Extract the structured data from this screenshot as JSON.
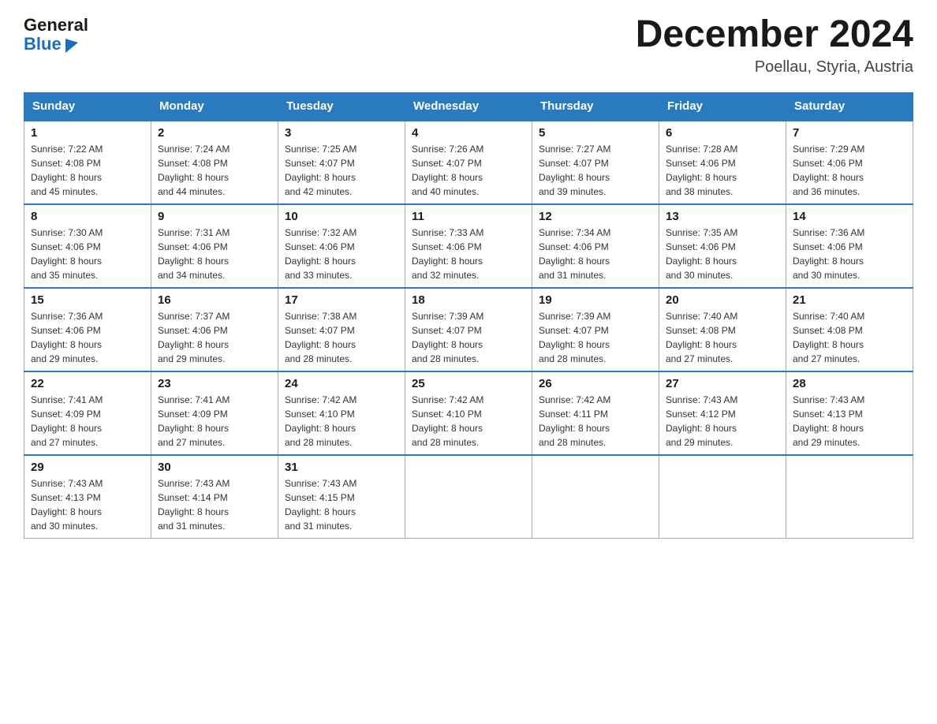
{
  "header": {
    "logo_general": "General",
    "logo_blue": "Blue",
    "month_title": "December 2024",
    "location": "Poellau, Styria, Austria"
  },
  "days_of_week": [
    "Sunday",
    "Monday",
    "Tuesday",
    "Wednesday",
    "Thursday",
    "Friday",
    "Saturday"
  ],
  "weeks": [
    [
      {
        "day": "1",
        "sunrise": "7:22 AM",
        "sunset": "4:08 PM",
        "daylight": "8 hours and 45 minutes."
      },
      {
        "day": "2",
        "sunrise": "7:24 AM",
        "sunset": "4:08 PM",
        "daylight": "8 hours and 44 minutes."
      },
      {
        "day": "3",
        "sunrise": "7:25 AM",
        "sunset": "4:07 PM",
        "daylight": "8 hours and 42 minutes."
      },
      {
        "day": "4",
        "sunrise": "7:26 AM",
        "sunset": "4:07 PM",
        "daylight": "8 hours and 40 minutes."
      },
      {
        "day": "5",
        "sunrise": "7:27 AM",
        "sunset": "4:07 PM",
        "daylight": "8 hours and 39 minutes."
      },
      {
        "day": "6",
        "sunrise": "7:28 AM",
        "sunset": "4:06 PM",
        "daylight": "8 hours and 38 minutes."
      },
      {
        "day": "7",
        "sunrise": "7:29 AM",
        "sunset": "4:06 PM",
        "daylight": "8 hours and 36 minutes."
      }
    ],
    [
      {
        "day": "8",
        "sunrise": "7:30 AM",
        "sunset": "4:06 PM",
        "daylight": "8 hours and 35 minutes."
      },
      {
        "day": "9",
        "sunrise": "7:31 AM",
        "sunset": "4:06 PM",
        "daylight": "8 hours and 34 minutes."
      },
      {
        "day": "10",
        "sunrise": "7:32 AM",
        "sunset": "4:06 PM",
        "daylight": "8 hours and 33 minutes."
      },
      {
        "day": "11",
        "sunrise": "7:33 AM",
        "sunset": "4:06 PM",
        "daylight": "8 hours and 32 minutes."
      },
      {
        "day": "12",
        "sunrise": "7:34 AM",
        "sunset": "4:06 PM",
        "daylight": "8 hours and 31 minutes."
      },
      {
        "day": "13",
        "sunrise": "7:35 AM",
        "sunset": "4:06 PM",
        "daylight": "8 hours and 30 minutes."
      },
      {
        "day": "14",
        "sunrise": "7:36 AM",
        "sunset": "4:06 PM",
        "daylight": "8 hours and 30 minutes."
      }
    ],
    [
      {
        "day": "15",
        "sunrise": "7:36 AM",
        "sunset": "4:06 PM",
        "daylight": "8 hours and 29 minutes."
      },
      {
        "day": "16",
        "sunrise": "7:37 AM",
        "sunset": "4:06 PM",
        "daylight": "8 hours and 29 minutes."
      },
      {
        "day": "17",
        "sunrise": "7:38 AM",
        "sunset": "4:07 PM",
        "daylight": "8 hours and 28 minutes."
      },
      {
        "day": "18",
        "sunrise": "7:39 AM",
        "sunset": "4:07 PM",
        "daylight": "8 hours and 28 minutes."
      },
      {
        "day": "19",
        "sunrise": "7:39 AM",
        "sunset": "4:07 PM",
        "daylight": "8 hours and 28 minutes."
      },
      {
        "day": "20",
        "sunrise": "7:40 AM",
        "sunset": "4:08 PM",
        "daylight": "8 hours and 27 minutes."
      },
      {
        "day": "21",
        "sunrise": "7:40 AM",
        "sunset": "4:08 PM",
        "daylight": "8 hours and 27 minutes."
      }
    ],
    [
      {
        "day": "22",
        "sunrise": "7:41 AM",
        "sunset": "4:09 PM",
        "daylight": "8 hours and 27 minutes."
      },
      {
        "day": "23",
        "sunrise": "7:41 AM",
        "sunset": "4:09 PM",
        "daylight": "8 hours and 27 minutes."
      },
      {
        "day": "24",
        "sunrise": "7:42 AM",
        "sunset": "4:10 PM",
        "daylight": "8 hours and 28 minutes."
      },
      {
        "day": "25",
        "sunrise": "7:42 AM",
        "sunset": "4:10 PM",
        "daylight": "8 hours and 28 minutes."
      },
      {
        "day": "26",
        "sunrise": "7:42 AM",
        "sunset": "4:11 PM",
        "daylight": "8 hours and 28 minutes."
      },
      {
        "day": "27",
        "sunrise": "7:43 AM",
        "sunset": "4:12 PM",
        "daylight": "8 hours and 29 minutes."
      },
      {
        "day": "28",
        "sunrise": "7:43 AM",
        "sunset": "4:13 PM",
        "daylight": "8 hours and 29 minutes."
      }
    ],
    [
      {
        "day": "29",
        "sunrise": "7:43 AM",
        "sunset": "4:13 PM",
        "daylight": "8 hours and 30 minutes."
      },
      {
        "day": "30",
        "sunrise": "7:43 AM",
        "sunset": "4:14 PM",
        "daylight": "8 hours and 31 minutes."
      },
      {
        "day": "31",
        "sunrise": "7:43 AM",
        "sunset": "4:15 PM",
        "daylight": "8 hours and 31 minutes."
      },
      null,
      null,
      null,
      null
    ]
  ],
  "labels": {
    "sunrise": "Sunrise:",
    "sunset": "Sunset:",
    "daylight": "Daylight:"
  }
}
